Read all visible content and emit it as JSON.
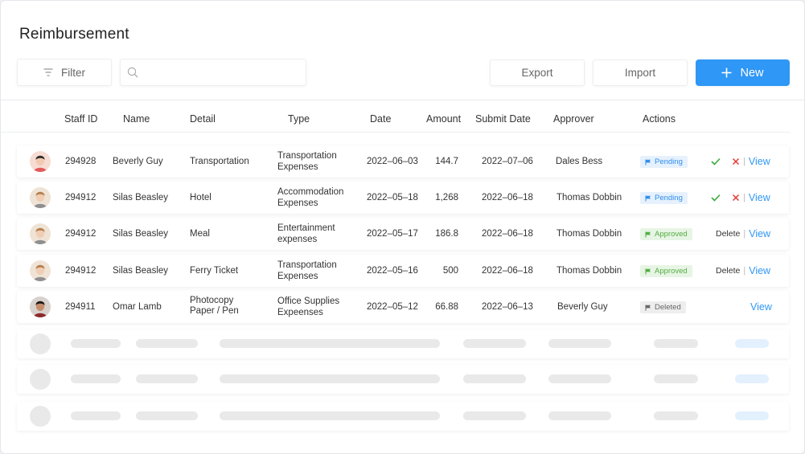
{
  "page": {
    "title": "Reimbursement"
  },
  "toolbar": {
    "filter_label": "Filter",
    "search_placeholder": "",
    "export_label": "Export",
    "import_label": "Import",
    "new_label": "New"
  },
  "columns": [
    "Staff ID",
    "Name",
    "Detail",
    "Type",
    "Date",
    "Amount",
    "Submit Date",
    "Approver",
    "Actions"
  ],
  "colors": {
    "accent": "#2f97f5",
    "pending": "#2f8ef0",
    "approved": "#56ad45",
    "approve_check": "#3aab3a",
    "reject_x": "#e53935"
  },
  "rows": [
    {
      "staff_id": "294928",
      "name": "Beverly Guy",
      "detail": [
        "Transportation"
      ],
      "type": [
        "Transportation",
        "Expenses"
      ],
      "date": "2022–06–03",
      "amount": "144.7",
      "submit_date": "2022–07–06",
      "approver": "Dales Bess",
      "status": "Pending",
      "actions": "approve-reject-view"
    },
    {
      "staff_id": "294912",
      "name": "Silas Beasley",
      "detail": [
        "Hotel"
      ],
      "type": [
        "Accommodation",
        "Expenses"
      ],
      "date": "2022–05–18",
      "amount": "1,268",
      "submit_date": "2022–06–18",
      "approver": "Thomas Dobbin",
      "status": "Pending",
      "actions": "approve-reject-view"
    },
    {
      "staff_id": "294912",
      "name": "Silas Beasley",
      "detail": [
        "Meal"
      ],
      "type": [
        "Entertainment",
        "expenses"
      ],
      "date": "2022–05–17",
      "amount": "186.8",
      "submit_date": "2022–06–18",
      "approver": "Thomas Dobbin",
      "status": "Approved",
      "actions": "delete-view"
    },
    {
      "staff_id": "294912",
      "name": "Silas Beasley",
      "detail": [
        "Ferry Ticket"
      ],
      "type": [
        "Transportation",
        "Expenses"
      ],
      "date": "2022–05–16",
      "amount": "500",
      "submit_date": "2022–06–18",
      "approver": "Thomas Dobbin",
      "status": "Approved",
      "actions": "delete-view"
    },
    {
      "staff_id": "294911",
      "name": "Omar Lamb",
      "detail": [
        "Photocopy",
        "Paper / Pen"
      ],
      "type": [
        "Office Supplies",
        "Expeenses"
      ],
      "date": "2022–05–12",
      "amount": "66.88",
      "submit_date": "2022–06–13",
      "approver": "Beverly Guy",
      "status": "Deleted",
      "actions": "view"
    }
  ],
  "actions": {
    "view_label": "View",
    "delete_label": "Delete",
    "separator": "|"
  }
}
